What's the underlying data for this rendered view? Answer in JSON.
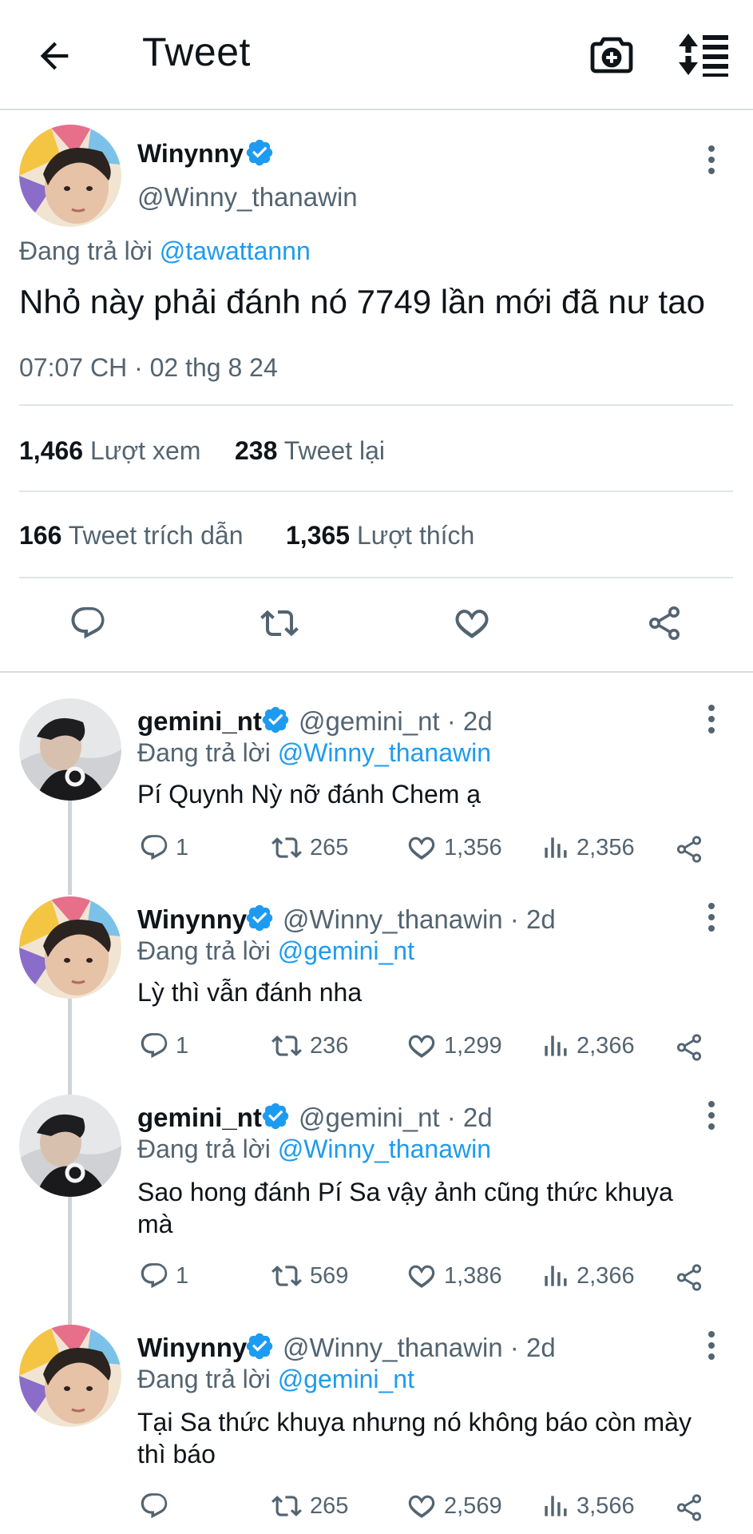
{
  "header": {
    "title": "Tweet",
    "back_icon": "arrow-left-icon",
    "camera_icon": "camera-plus-icon",
    "sort_icon": "sort-icon"
  },
  "main_tweet": {
    "display_name": "Winynny",
    "handle": "@Winny_thanawin",
    "reply_prefix": "Đang trả lời",
    "reply_to": "@tawattannn",
    "text": "Nhỏ này phải đánh nó 7749 lần mới đã nư tao",
    "timestamp": "07:07 CH · 02 thg 8 24",
    "stats": {
      "views_count": "1,466",
      "views_label": "Lượt xem",
      "retweets_count": "238",
      "retweets_label": "Tweet lại",
      "quotes_count": "166",
      "quotes_label": "Tweet trích dẫn",
      "likes_count": "1,365",
      "likes_label": "Lượt thích"
    }
  },
  "replies": [
    {
      "display_name": "gemini_nt",
      "handle_meta": "@gemini_nt · 2d",
      "reply_prefix": "Đang trả lời",
      "reply_to": "@Winny_thanawin",
      "text": "Pí Quynh Nỳ nỡ đánh Chem ạ",
      "replies": "1",
      "retweets": "265",
      "likes": "1,356",
      "views": "2,356"
    },
    {
      "display_name": "Winynny",
      "handle_meta": "@Winny_thanawin · 2d",
      "reply_prefix": "Đang trả lời",
      "reply_to": "@gemini_nt",
      "text": "Lỳ thì vẫn đánh nha",
      "replies": "1",
      "retweets": "236",
      "likes": "1,299",
      "views": "2,366"
    },
    {
      "display_name": "gemini_nt",
      "handle_meta": "@gemini_nt · 2d",
      "reply_prefix": "Đang trả lời",
      "reply_to": "@Winny_thanawin",
      "text_line1": "Sao hong đánh Pí Sa vậy ảnh cũng thức khuya",
      "text_line2": "mà",
      "replies": "1",
      "retweets": "569",
      "likes": "1,386",
      "views": "2,366"
    },
    {
      "display_name": "Winynny",
      "handle_meta": "@Winny_thanawin · 2d",
      "reply_prefix": "Đang trả lời",
      "reply_to": "@gemini_nt",
      "text_line1": "Tại Sa thức khuya nhưng nó không báo còn mày",
      "text_line2": "thì báo",
      "replies": "",
      "retweets": "265",
      "likes": "2,569",
      "views": "3,566"
    }
  ],
  "colors": {
    "accent": "#1d9bf0",
    "text": "#0f1419",
    "muted": "#536471",
    "divider": "#e1e5e8"
  }
}
